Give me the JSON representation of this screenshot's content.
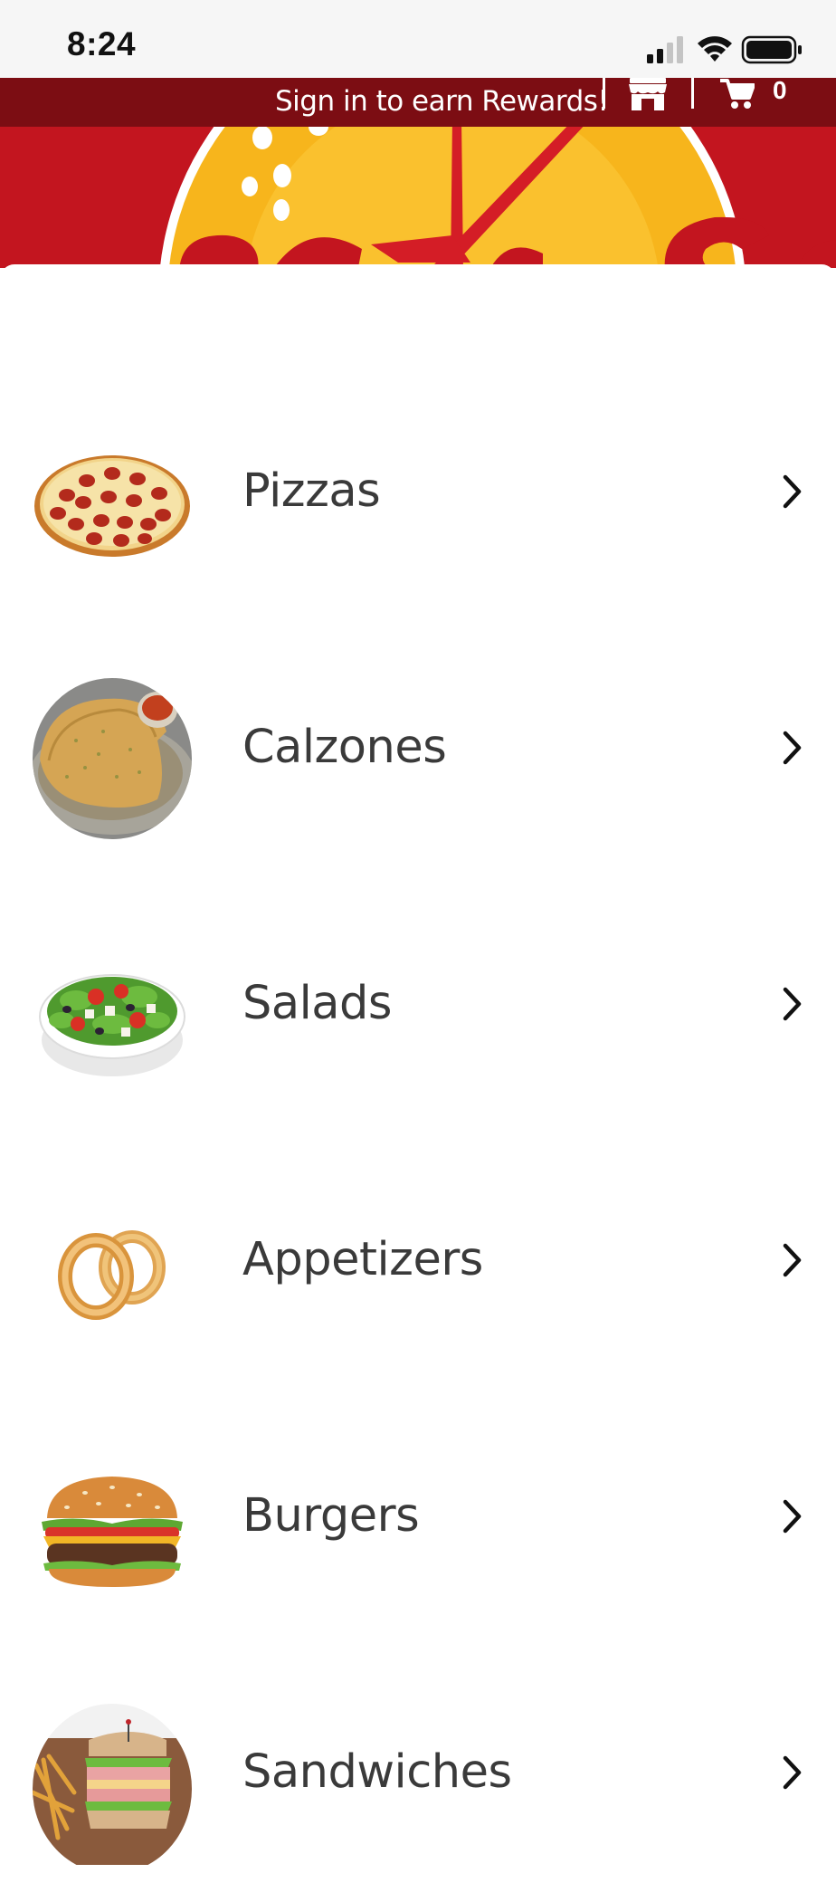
{
  "status_bar": {
    "time": "8:24"
  },
  "header": {
    "rewards_text": "Sign in to earn Rewards!",
    "cart_count": "0",
    "store_icon": "storefront-icon",
    "cart_icon": "shopping-cart-icon"
  },
  "colors": {
    "header_bar": "#7c0d13",
    "banner_red": "#c3151f",
    "banner_yellow": "#f7b51c",
    "label_text": "#3a3a3a"
  },
  "menu": {
    "items": [
      {
        "label": "Pizzas",
        "image": "pizza-image"
      },
      {
        "label": "Calzones",
        "image": "calzone-image"
      },
      {
        "label": "Salads",
        "image": "salad-image"
      },
      {
        "label": "Appetizers",
        "image": "onion-rings-image"
      },
      {
        "label": "Burgers",
        "image": "burger-image"
      },
      {
        "label": "Sandwiches",
        "image": "sandwich-image"
      }
    ]
  }
}
